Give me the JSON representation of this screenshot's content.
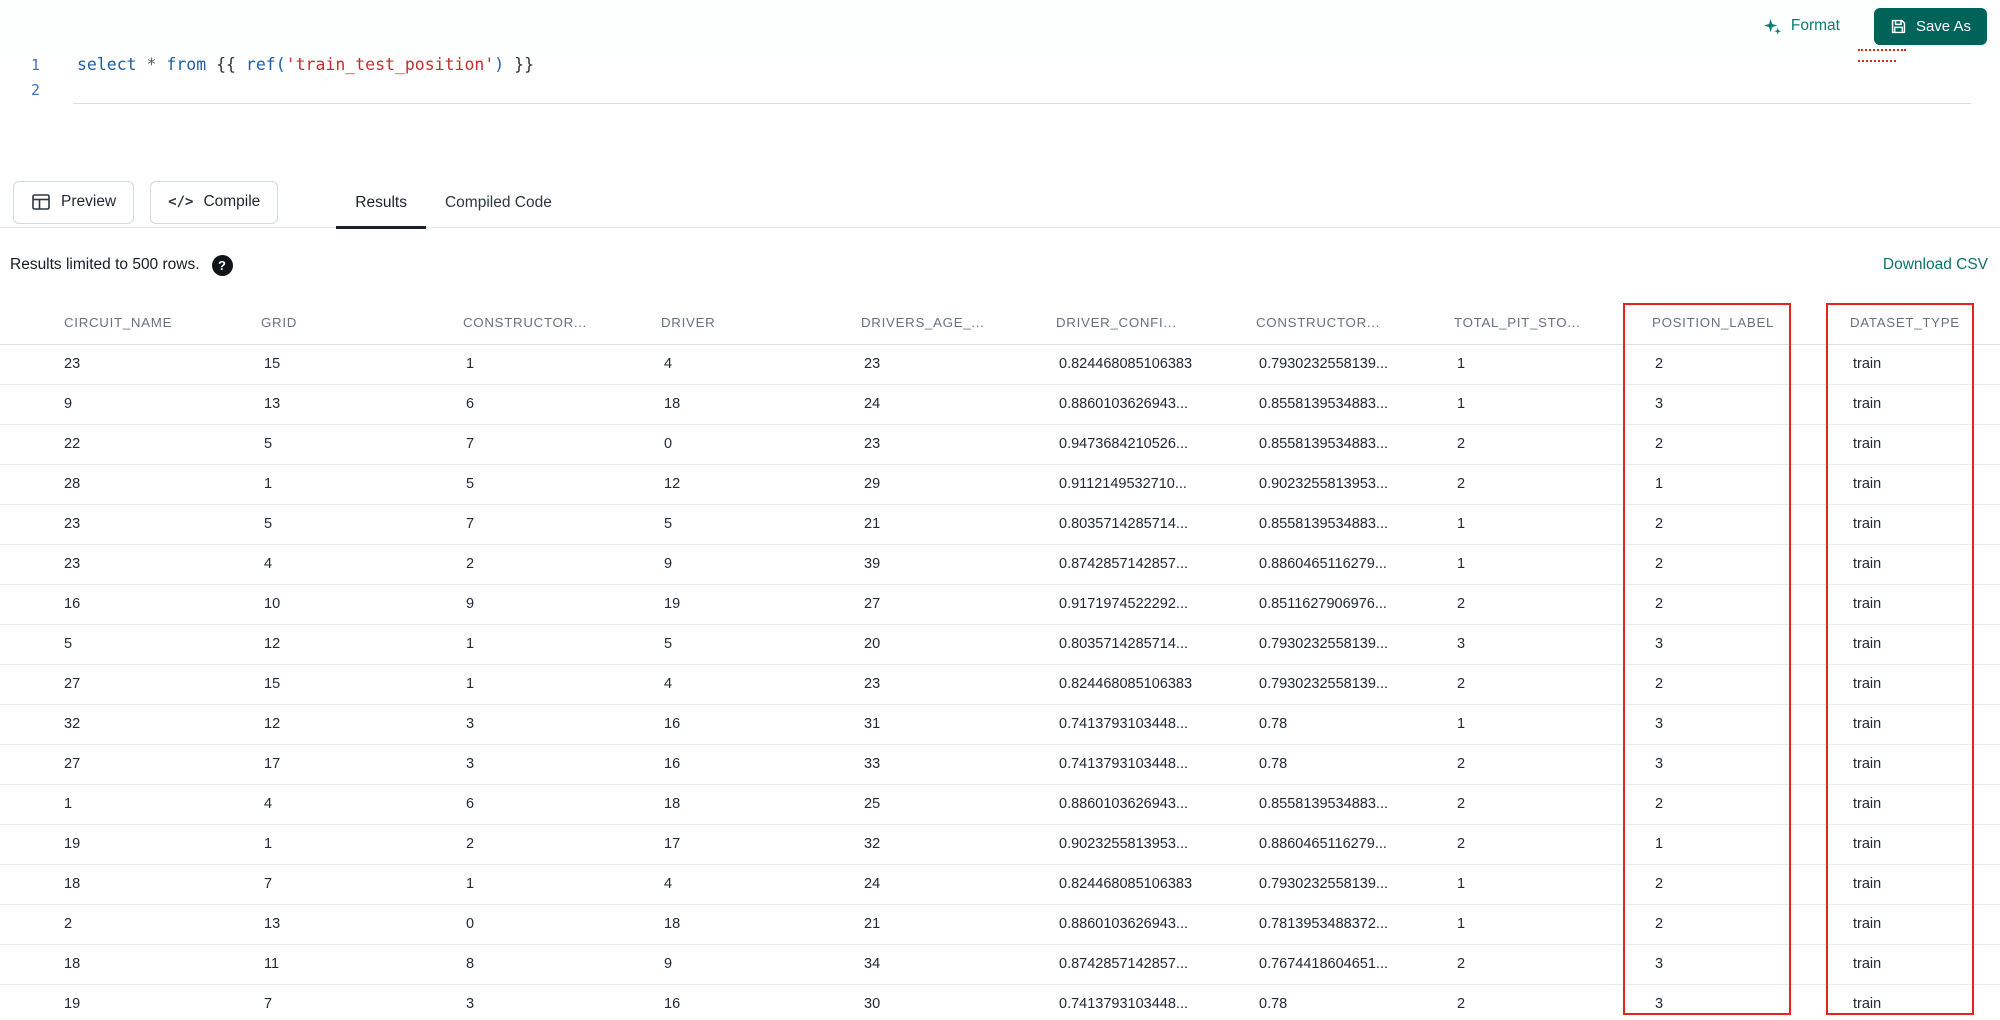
{
  "colors": {
    "accent_teal": "#00635a",
    "format_teal": "#0b7d72",
    "link_teal": "#0d7268",
    "annotation_red": "#e8231d"
  },
  "topbar": {
    "format_label": "Format",
    "save_as_label": "Save As"
  },
  "editor": {
    "line_numbers": [
      "1",
      "2"
    ],
    "code_tokens": [
      {
        "text": "select",
        "type": "keyword"
      },
      {
        "text": " ",
        "type": "plain"
      },
      {
        "text": "*",
        "type": "operator"
      },
      {
        "text": " ",
        "type": "plain"
      },
      {
        "text": "from",
        "type": "keyword"
      },
      {
        "text": " {{ ",
        "type": "plain"
      },
      {
        "text": "ref(",
        "type": "function"
      },
      {
        "text": "'train_test_position'",
        "type": "string"
      },
      {
        "text": ")",
        "type": "function"
      },
      {
        "text": " }}",
        "type": "plain"
      }
    ]
  },
  "actions": {
    "preview_label": "Preview",
    "compile_label": "Compile",
    "compile_icon_glyph": "</>"
  },
  "tabs": [
    {
      "label": "Results",
      "active": true
    },
    {
      "label": "Compiled Code",
      "active": false
    }
  ],
  "results_bar": {
    "limit_text": "Results limited to 500 rows.",
    "help_glyph": "?",
    "download_label": "Download CSV"
  },
  "table": {
    "columns": [
      "CIRCUIT_NAME",
      "GRID",
      "CONSTRUCTOR...",
      "DRIVER",
      "DRIVERS_AGE_...",
      "DRIVER_CONFI...",
      "CONSTRUCTOR...",
      "TOTAL_PIT_STO...",
      "POSITION_LABEL",
      "DATASET_TYPE"
    ],
    "rows": [
      [
        "23",
        "15",
        "1",
        "4",
        "23",
        "0.824468085106383",
        "0.7930232558139...",
        "1",
        "2",
        "train"
      ],
      [
        "9",
        "13",
        "6",
        "18",
        "24",
        "0.8860103626943...",
        "0.8558139534883...",
        "1",
        "3",
        "train"
      ],
      [
        "22",
        "5",
        "7",
        "0",
        "23",
        "0.9473684210526...",
        "0.8558139534883...",
        "2",
        "2",
        "train"
      ],
      [
        "28",
        "1",
        "5",
        "12",
        "29",
        "0.9112149532710...",
        "0.9023255813953...",
        "2",
        "1",
        "train"
      ],
      [
        "23",
        "5",
        "7",
        "5",
        "21",
        "0.8035714285714...",
        "0.8558139534883...",
        "1",
        "2",
        "train"
      ],
      [
        "23",
        "4",
        "2",
        "9",
        "39",
        "0.8742857142857...",
        "0.8860465116279...",
        "1",
        "2",
        "train"
      ],
      [
        "16",
        "10",
        "9",
        "19",
        "27",
        "0.9171974522292...",
        "0.8511627906976...",
        "2",
        "2",
        "train"
      ],
      [
        "5",
        "12",
        "1",
        "5",
        "20",
        "0.8035714285714...",
        "0.7930232558139...",
        "3",
        "3",
        "train"
      ],
      [
        "27",
        "15",
        "1",
        "4",
        "23",
        "0.824468085106383",
        "0.7930232558139...",
        "2",
        "2",
        "train"
      ],
      [
        "32",
        "12",
        "3",
        "16",
        "31",
        "0.7413793103448...",
        "0.78",
        "1",
        "3",
        "train"
      ],
      [
        "27",
        "17",
        "3",
        "16",
        "33",
        "0.7413793103448...",
        "0.78",
        "2",
        "3",
        "train"
      ],
      [
        "1",
        "4",
        "6",
        "18",
        "25",
        "0.8860103626943...",
        "0.8558139534883...",
        "2",
        "2",
        "train"
      ],
      [
        "19",
        "1",
        "2",
        "17",
        "32",
        "0.9023255813953...",
        "0.8860465116279...",
        "2",
        "1",
        "train"
      ],
      [
        "18",
        "7",
        "1",
        "4",
        "24",
        "0.824468085106383",
        "0.7930232558139...",
        "1",
        "2",
        "train"
      ],
      [
        "2",
        "13",
        "0",
        "18",
        "21",
        "0.8860103626943...",
        "0.7813953488372...",
        "1",
        "2",
        "train"
      ],
      [
        "18",
        "11",
        "8",
        "9",
        "34",
        "0.8742857142857...",
        "0.7674418604651...",
        "2",
        "3",
        "train"
      ],
      [
        "19",
        "7",
        "3",
        "16",
        "30",
        "0.7413793103448...",
        "0.78",
        "2",
        "3",
        "train"
      ]
    ],
    "highlighted_columns": [
      "POSITION_LABEL",
      "DATASET_TYPE"
    ]
  }
}
